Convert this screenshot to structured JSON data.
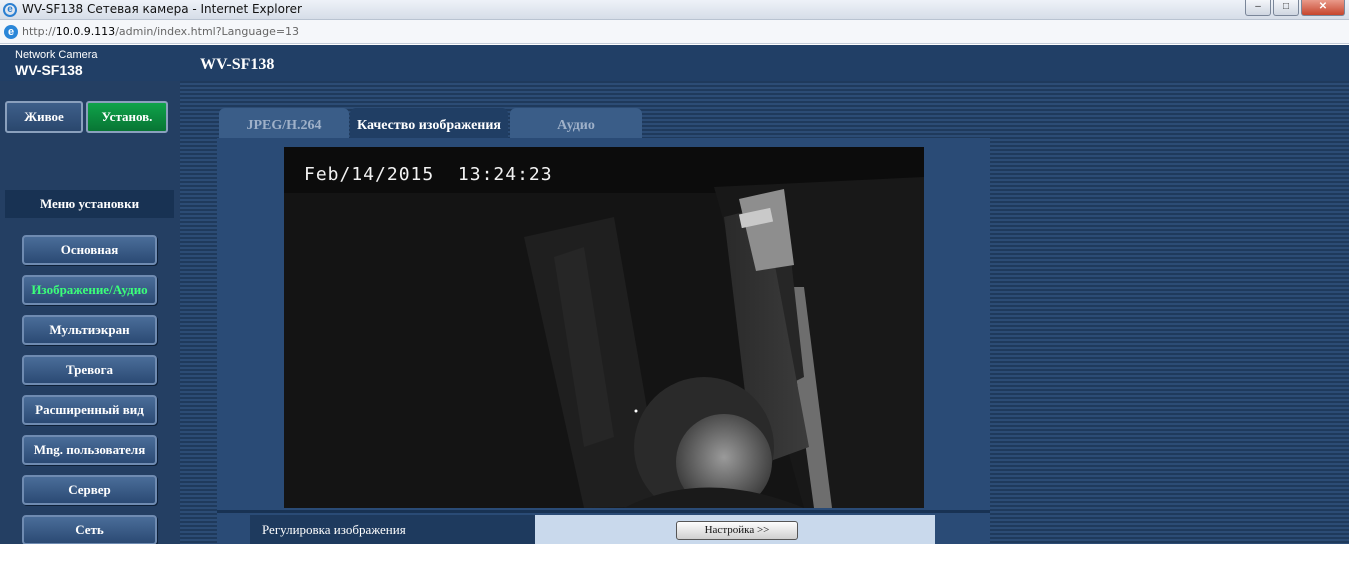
{
  "window": {
    "title": "WV-SF138 Сетевая камера - Internet Explorer",
    "minimize": "–",
    "maximize": "□",
    "close": "✕",
    "icon": "ie-icon"
  },
  "address_bar": {
    "protocol": "http://",
    "host": "10.0.9.113",
    "path": "/admin/index.html?Language=13",
    "icon": "e-icon"
  },
  "header": {
    "brand_small": "Network Camera",
    "brand_model": "WV-SF138",
    "page_title": "WV-SF138"
  },
  "mode_tabs": {
    "live": "Живое",
    "setup": "Установ."
  },
  "setup_menu": {
    "header": "Меню установки",
    "items": [
      {
        "label": "Основная",
        "active": false
      },
      {
        "label": "Изображение/Аудио",
        "active": true
      },
      {
        "label": "Мультиэкран",
        "active": false
      },
      {
        "label": "Тревога",
        "active": false
      },
      {
        "label": "Расширенный вид",
        "active": false
      },
      {
        "label": "Mng. пользователя",
        "active": false
      },
      {
        "label": "Сервер",
        "active": false
      },
      {
        "label": "Сеть",
        "active": false
      }
    ]
  },
  "content_tabs": [
    {
      "label": "JPEG/H.264",
      "active": false
    },
    {
      "label": "Качество изображения",
      "active": true
    },
    {
      "label": "Аудио",
      "active": false
    }
  ],
  "video": {
    "osd_date": "Feb/14/2015",
    "osd_time": "13:24:23"
  },
  "image_adjust": {
    "label": "Регулировка изображения",
    "button": "Настройка >>"
  },
  "colors": {
    "active_menu_text": "#3bff7a",
    "setup_tab": "#0a8a3e",
    "header_bg": "#213f66"
  }
}
